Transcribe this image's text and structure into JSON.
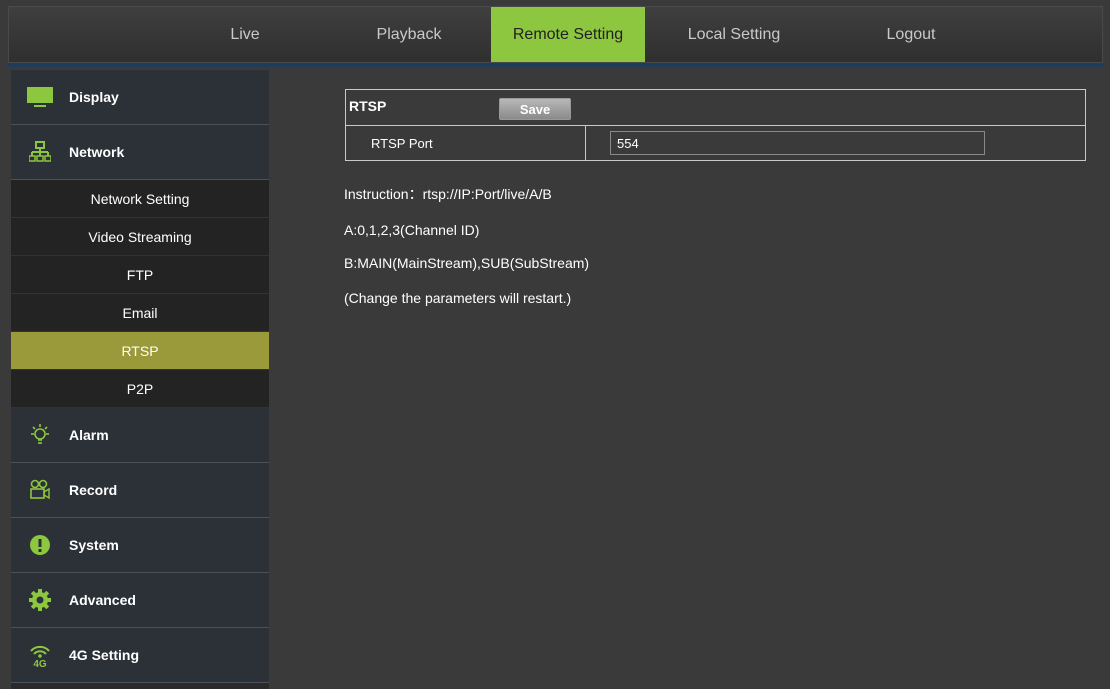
{
  "nav": {
    "tabs": [
      {
        "label": "Live"
      },
      {
        "label": "Playback"
      },
      {
        "label": "Remote Setting"
      },
      {
        "label": "Local Setting"
      },
      {
        "label": "Logout"
      }
    ]
  },
  "sidebar": {
    "display": "Display",
    "network": "Network",
    "network_sub": [
      "Network Setting",
      "Video Streaming",
      "FTP",
      "Email",
      "RTSP",
      "P2P"
    ],
    "alarm": "Alarm",
    "record": "Record",
    "system": "System",
    "advanced": "Advanced",
    "g4": "4G Setting"
  },
  "rtsp": {
    "title": "RTSP",
    "save_label": "Save",
    "port_label": "RTSP Port",
    "port_value": "554"
  },
  "instructions": [
    "Instruction：rtsp://IP:Port/live/A/B",
    "A:0,1,2,3(Channel ID)",
    "B:MAIN(MainStream),SUB(SubStream)",
    "(Change the parameters will restart.)"
  ],
  "colors": {
    "accent": "#8dc63f",
    "active_sub": "#9a9a3a"
  }
}
